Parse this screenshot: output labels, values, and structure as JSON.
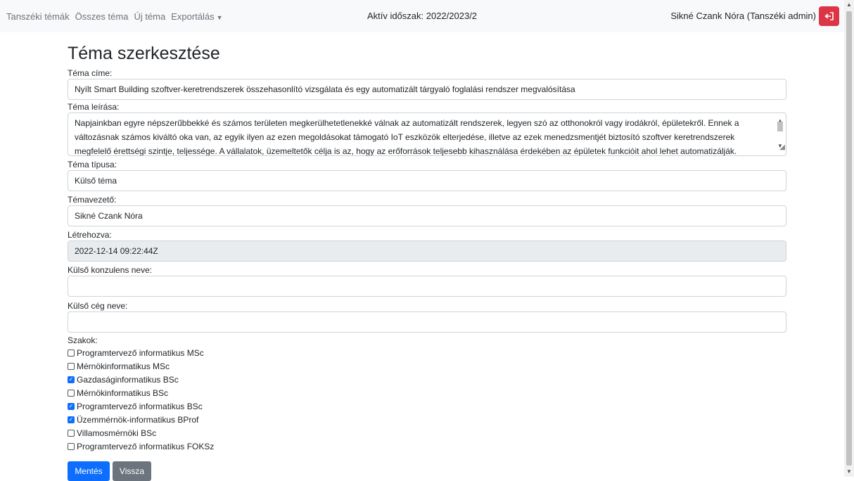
{
  "nav": {
    "links": [
      "Tanszéki témák",
      "Összes téma",
      "Új téma",
      "Exportálás"
    ],
    "period": "Aktív időszak: 2022/2023/2",
    "user": "Sikné Czank Nóra (Tanszéki admin)"
  },
  "form": {
    "heading": "Téma szerkesztése",
    "title_label": "Téma címe:",
    "title_value": "Nyílt Smart Building szoftver-keretrendszerek összehasonlító vizsgálata és egy automatizált tárgyaló foglalási rendszer megvalósítása",
    "desc_label": "Téma leírása:",
    "desc_value": "Napjainkban egyre népszerűbbekké és számos területen megkerülhetetlenekké válnak az automatizált rendszerek, legyen szó az otthonokról vagy irodákról, épületekről. Ennek a változásnak számos kiváltó oka van, az egyik ilyen az ezen megoldásokat támogató IoT eszközök elterjedése, illetve az ezek menedzsmentjét biztosító szoftver keretrendszerek megfelelő érettségi szintje, teljessége. A vállalatok, üzemeltetők célja is az, hogy az erőforrások teljesebb kihasználása érdekében az épületek funkcióit ahol lehet automatizálják.",
    "type_label": "Téma típusa:",
    "type_value": "Külső téma",
    "supervisor_label": "Témavezető:",
    "supervisor_value": "Sikné Czank Nóra",
    "created_label": "Létrehozva:",
    "created_value": "2022-12-14 09:22:44Z",
    "consultant_label": "Külső konzulens neve:",
    "consultant_value": "",
    "company_label": "Külső cég neve:",
    "company_value": "",
    "majors_label": "Szakok:",
    "majors": [
      {
        "label": "Programtervező informatikus MSc",
        "checked": false
      },
      {
        "label": "Mérnökinformatikus MSc",
        "checked": false
      },
      {
        "label": "Gazdaságinformatikus BSc",
        "checked": true
      },
      {
        "label": "Mérnökinformatikus BSc",
        "checked": false
      },
      {
        "label": "Programtervező informatikus BSc",
        "checked": true
      },
      {
        "label": "Üzemmérnök-informatikus BProf",
        "checked": true
      },
      {
        "label": "Villamosmérnöki BSc",
        "checked": false
      },
      {
        "label": "Programtervező informatikus FOKSz",
        "checked": false
      }
    ],
    "save_label": "Mentés",
    "back_label": "Vissza"
  },
  "colors": {
    "primary": "#0d6efd",
    "danger": "#dc3545",
    "secondary": "#6c757d",
    "navbar": "#f8f9fa"
  }
}
